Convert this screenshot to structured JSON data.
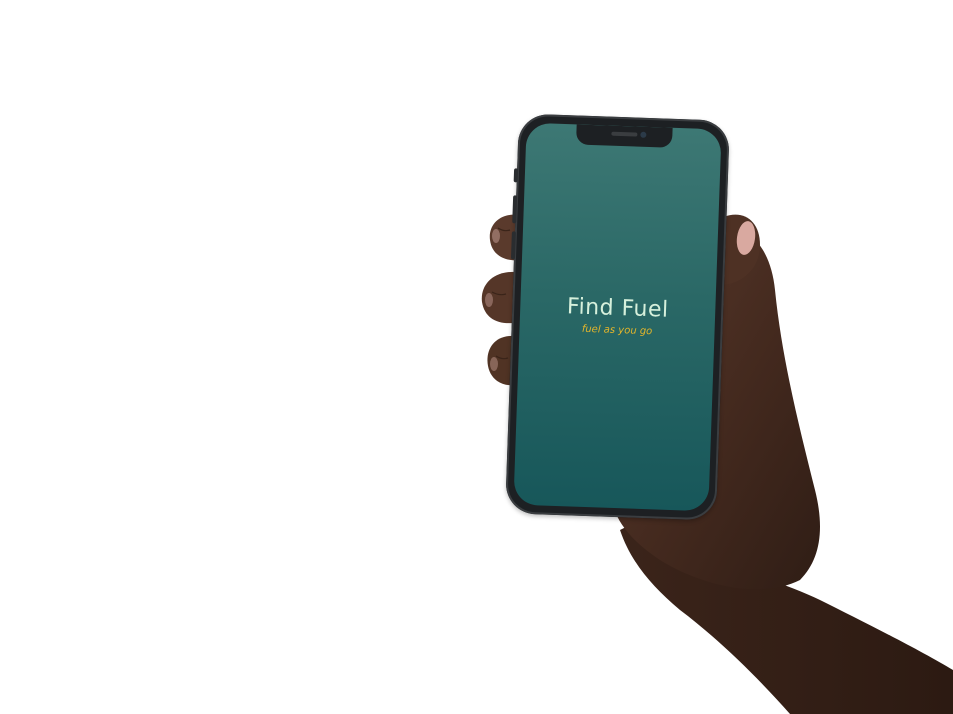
{
  "app": {
    "title": "Find Fuel",
    "tagline": "fuel as you go"
  },
  "colors": {
    "screen_top": "#3d7874",
    "screen_bottom": "#17575a",
    "title": "#d6f0dc",
    "tagline": "#e5b62a",
    "skin": "#4a2e22",
    "phone_body": "#1d2023"
  },
  "icons": {
    "camera": "front-camera-icon",
    "speaker": "earpiece-speaker-icon"
  }
}
